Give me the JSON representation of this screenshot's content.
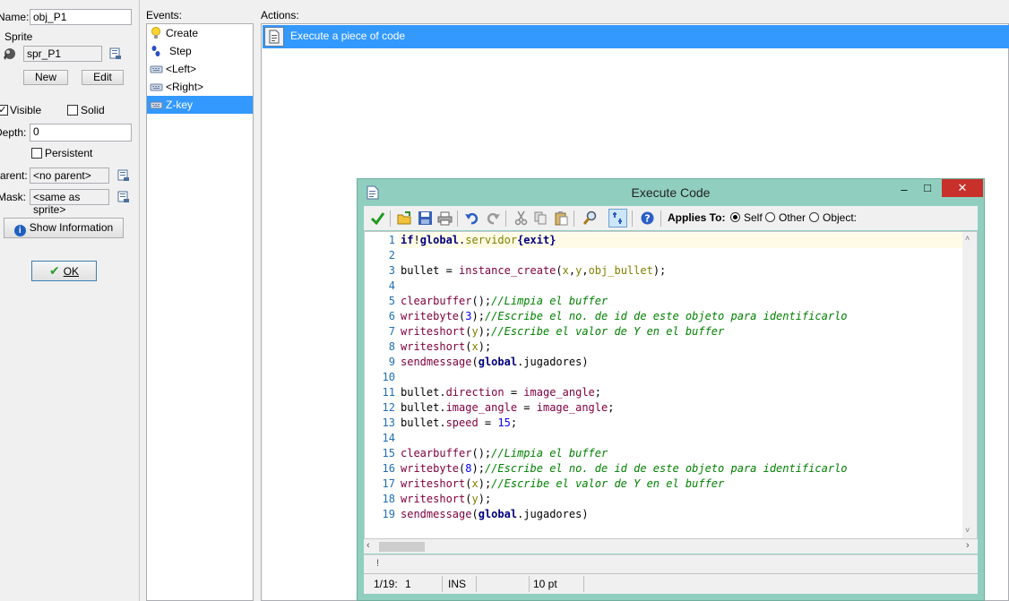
{
  "object_props": {
    "name_label": "Name:",
    "name_value": "obj_P1",
    "sprite_group_label": "Sprite",
    "sprite_value": "spr_P1",
    "new_button": "New",
    "edit_button": "Edit",
    "visible_label": "Visible",
    "visible_checked": "✓",
    "solid_label": "Solid",
    "depth_label": "Depth:",
    "depth_value": "0",
    "persistent_label": "Persistent",
    "parent_label": "Parent:",
    "parent_value": "<no parent>",
    "mask_label": "Mask:",
    "mask_value": "<same as sprite>",
    "show_info_button": "Show Information",
    "ok_button": "OK"
  },
  "events": {
    "header": "Events:",
    "items": [
      {
        "label": "Create",
        "icon": "lightbulb-icon"
      },
      {
        "label": "Step",
        "icon": "steps-icon"
      },
      {
        "label": "<Left>",
        "icon": "keyboard-icon"
      },
      {
        "label": "<Right>",
        "icon": "keyboard-icon"
      },
      {
        "label": "Z-key",
        "icon": "keyboard-icon",
        "selected": true
      }
    ]
  },
  "actions": {
    "header": "Actions:",
    "items": [
      {
        "label": "Execute a piece of code",
        "icon": "code-page-icon"
      }
    ]
  },
  "code_window": {
    "title": "Execute Code",
    "minimize": "–",
    "maximize": "□",
    "close": "✕",
    "applies_to_label": "Applies To:",
    "applies_options": [
      {
        "label": "Self",
        "selected": true
      },
      {
        "label": "Other",
        "selected": false
      },
      {
        "label": "Object:",
        "selected": false
      }
    ],
    "line_numbers": [
      "1",
      "2",
      "3",
      "4",
      "5",
      "6",
      "7",
      "8",
      "9",
      "10",
      "11",
      "12",
      "13",
      "14",
      "15",
      "16",
      "17",
      "18",
      "19"
    ],
    "error_marker": "!",
    "status": {
      "position": "1/19:",
      "column": "1",
      "mode": "INS",
      "font_size": "10 pt"
    }
  },
  "colors": {
    "selection": "#3399ff",
    "window_frame": "#90cfbf",
    "keyword": "#000080",
    "function": "#800040",
    "comment": "#008000",
    "number": "#0000ff"
  }
}
